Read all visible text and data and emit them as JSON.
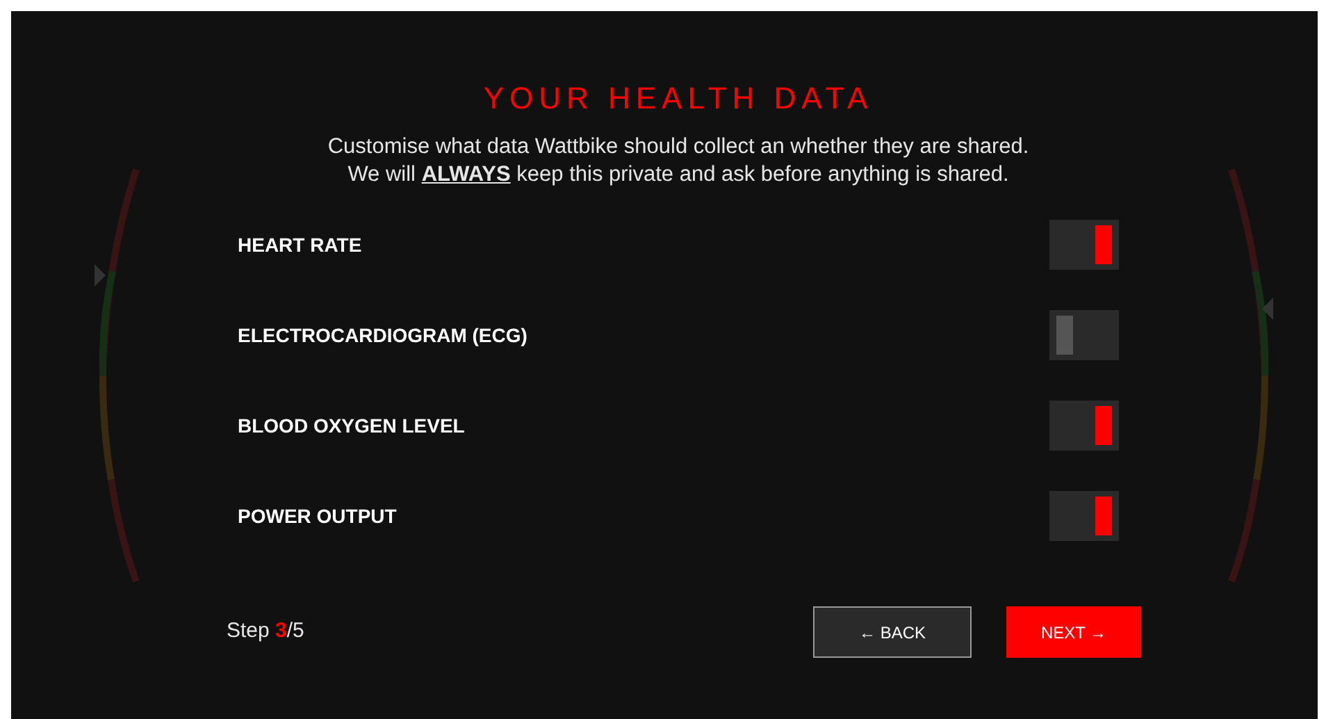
{
  "dialog": {
    "title": "YOUR HEALTH DATA",
    "intro": [
      "Customise what data Wattbike should collect an whether they are shared.",
      "We will **ALWAYS** keep this private and ask before anything is shared."
    ],
    "toggles": [
      {
        "label": "HEART RATE",
        "on": true
      },
      {
        "label": "ELECTROCARDIOGRAM (ECG)",
        "on": false
      },
      {
        "label": "BLOOD OXYGEN LEVEL",
        "on": true
      },
      {
        "label": "POWER OUTPUT",
        "on": true
      }
    ],
    "step": {
      "prefix": "Step ",
      "current": "3",
      "total": "/5"
    },
    "back": "← BACK",
    "next": "NEXT →"
  }
}
